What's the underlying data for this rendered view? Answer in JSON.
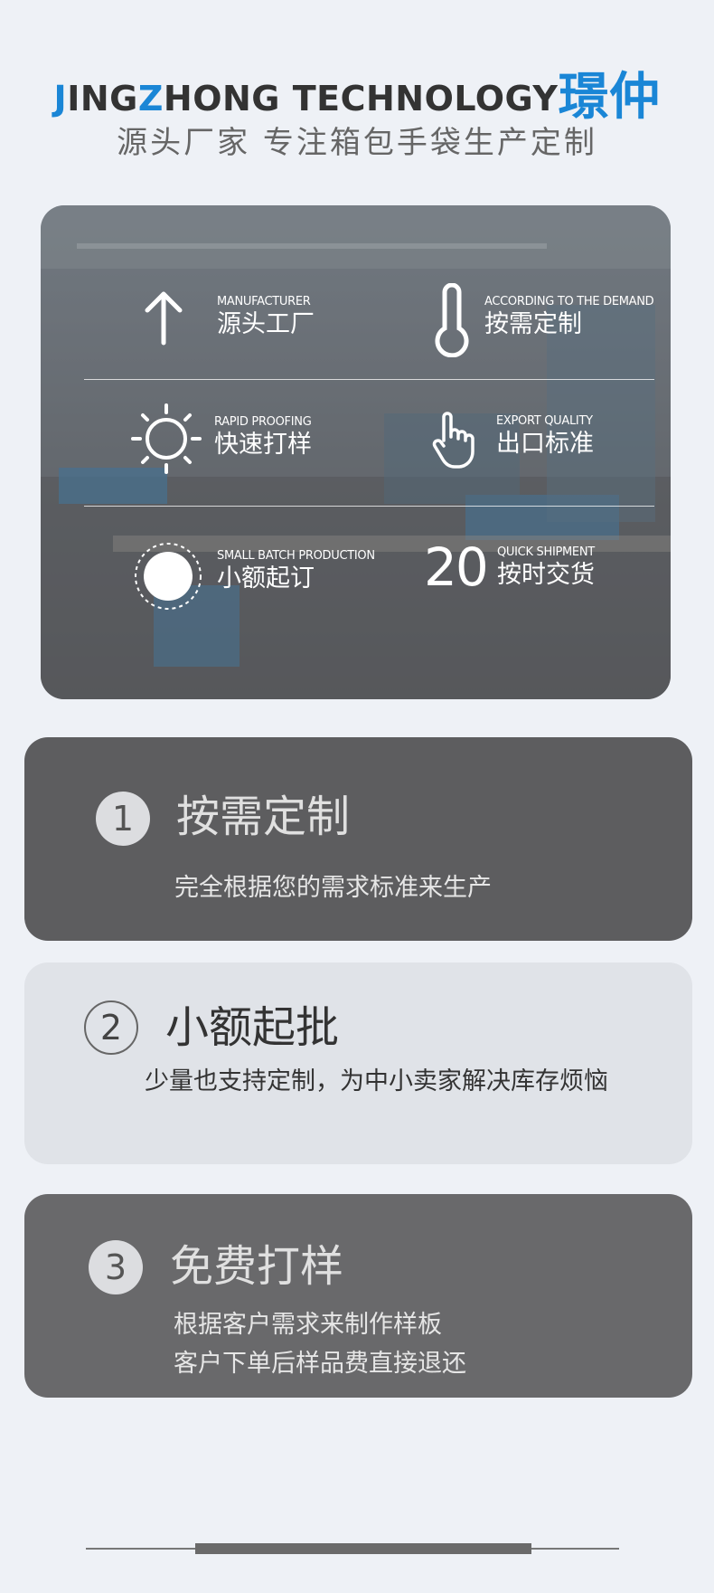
{
  "header": {
    "brand_j": "J",
    "brand_ing": "ING",
    "brand_z": "Z",
    "brand_rest": "HONG TECHNOLOGY",
    "brand_cn": "璟仲",
    "tagline": "源头厂家 专注箱包手袋生产定制"
  },
  "features": [
    {
      "en": "MANUFACTURER",
      "zh": "源头工厂",
      "icon": "arrow-up-icon"
    },
    {
      "en": "ACCORDING TO THE DEMAND",
      "zh": "按需定制",
      "icon": "thermometer-icon"
    },
    {
      "en": "RAPID PROOFING",
      "zh": "快速打样",
      "icon": "sun-icon"
    },
    {
      "en": "EXPORT QUALITY",
      "zh": "出口标准",
      "icon": "hand-pointer-icon"
    },
    {
      "en": "SMALL BATCH PRODUCTION",
      "zh": "小额起订",
      "icon": "dotted-circle-icon"
    },
    {
      "en": "QUICK SHIPMENT",
      "zh": "按时交货",
      "number": "20"
    }
  ],
  "cards": [
    {
      "num": "1",
      "title": "按需定制",
      "lines": [
        "完全根据您的需求标准来生产"
      ]
    },
    {
      "num": "2",
      "title": "小额起批",
      "lines": [
        "少量也支持定制，为中小卖家解决库存烦恼"
      ]
    },
    {
      "num": "3",
      "title": "免费打样",
      "lines": [
        "根据客户需求来制作样板",
        "客户下单后样品费直接退还"
      ]
    }
  ],
  "colors": {
    "accent": "#1a86d6",
    "page_bg": "#eef1f6",
    "card_dark": "#5d5d5f",
    "card_light": "#e0e3e8"
  }
}
